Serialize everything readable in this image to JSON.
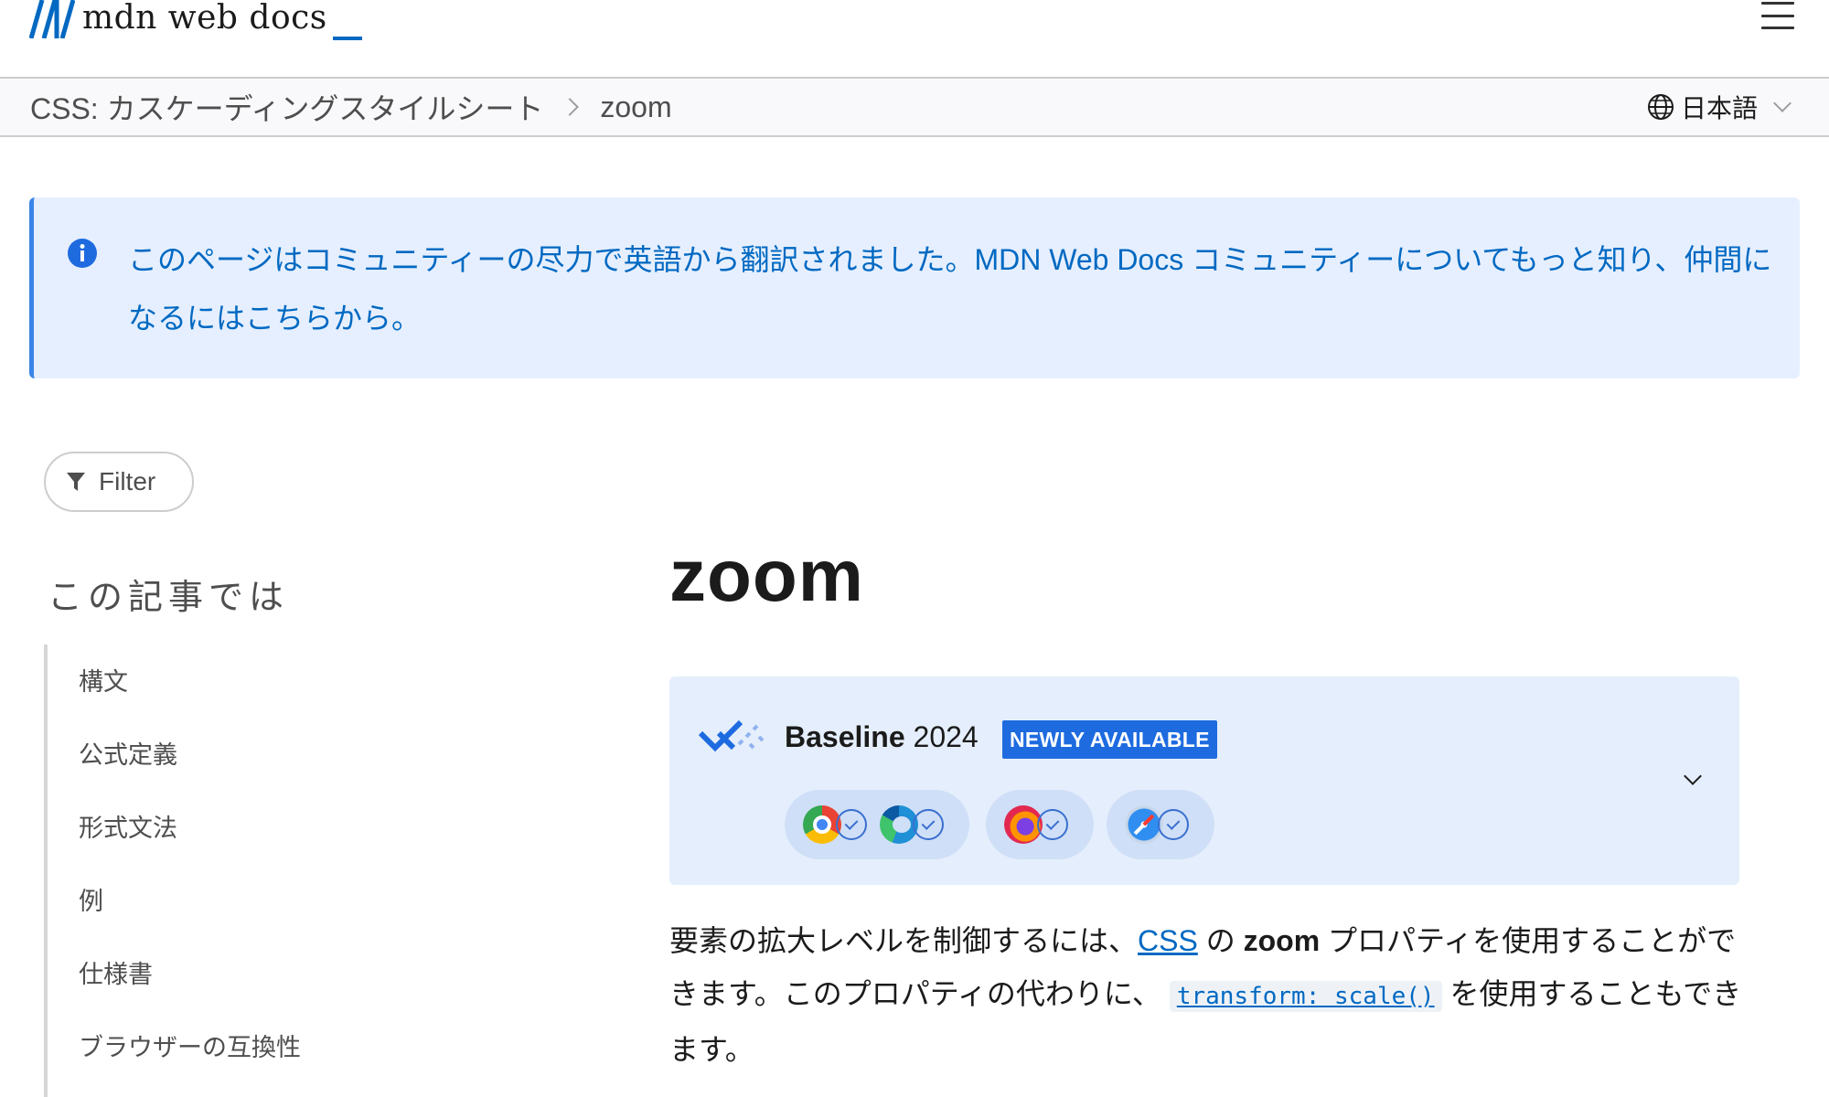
{
  "header": {
    "logo_text": "mdn web docs",
    "menu_icon": "hamburger-menu-icon"
  },
  "breadcrumb": {
    "items": [
      "CSS: カスケーディングスタイルシート",
      "zoom"
    ],
    "language": "日本語"
  },
  "notice": {
    "text": "このページはコミュニティーの尽力で英語から翻訳されました。MDN Web Docs コミュニティーについてもっと知り、仲間になるにはこちらから。",
    "icon": "info-icon"
  },
  "sidebar": {
    "filter_label": "Filter",
    "toc_title": "この記事では",
    "toc_items": [
      "構文",
      "公式定義",
      "形式文法",
      "例",
      "仕様書",
      "ブラウザーの互換性"
    ]
  },
  "article": {
    "title": "zoom",
    "baseline": {
      "label": "Baseline",
      "year": "2024",
      "badge": "NEWLY AVAILABLE",
      "browsers": [
        "chrome-icon",
        "edge-icon",
        "firefox-icon",
        "safari-icon"
      ]
    },
    "intro": {
      "part1": "要素の拡大レベルを制御するには、",
      "link_css": "CSS",
      "part2": " の ",
      "property": "zoom",
      "part3": " プロパティを使用することができます。このプロパティの代わりに、 ",
      "code": "transform: scale()",
      "part4": " を使用することもできます。"
    }
  },
  "colors": {
    "accent": "#0069c2",
    "notice_bg": "#e6efff",
    "baseline_bg": "#e5eefc",
    "badge_bg": "#1e6be0"
  }
}
